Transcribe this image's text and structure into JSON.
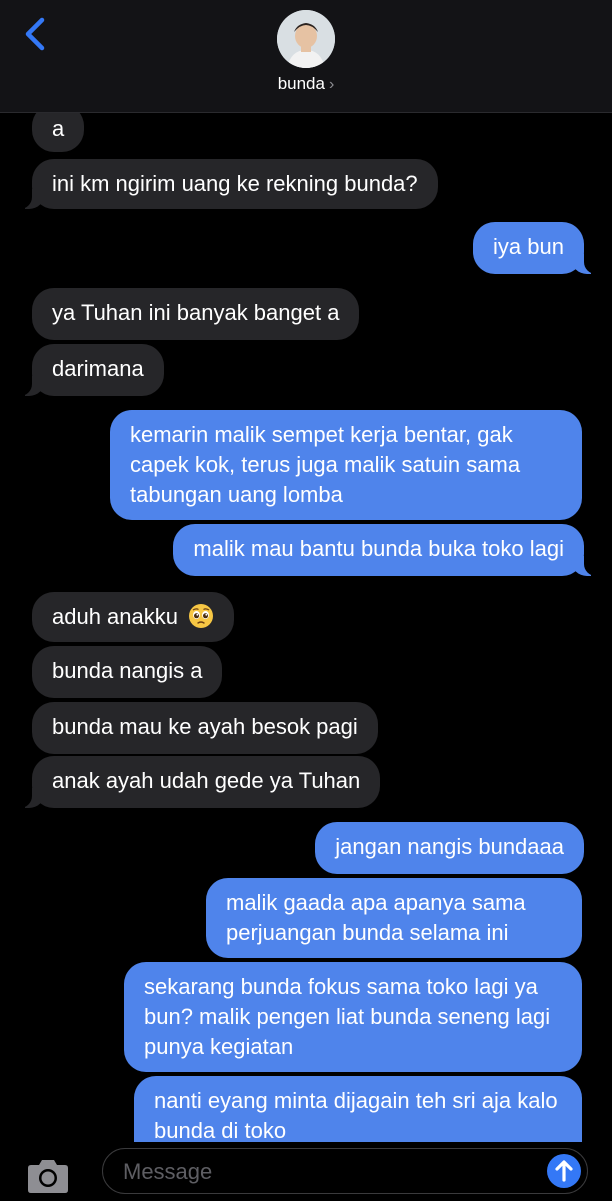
{
  "header": {
    "contact_name": "bunda",
    "chevron": "›",
    "back_icon": "chevron-left-icon",
    "accent": "#3478f6"
  },
  "messages": [
    {
      "from": "contact",
      "text": "a"
    },
    {
      "from": "contact",
      "text": "ini km ngirim uang ke rekning bunda?"
    },
    {
      "from": "me",
      "text": "iya bun"
    },
    {
      "from": "contact",
      "text": "ya Tuhan ini banyak banget a"
    },
    {
      "from": "contact",
      "text": "darimana"
    },
    {
      "from": "me",
      "text": "kemarin malik sempet kerja bentar, gak capek kok, terus juga malik satuin sama tabungan uang lomba"
    },
    {
      "from": "me",
      "text": "malik mau bantu bunda buka toko lagi"
    },
    {
      "from": "contact",
      "text": "aduh anakku",
      "emoji": "pleading-face"
    },
    {
      "from": "contact",
      "text": "bunda nangis a"
    },
    {
      "from": "contact",
      "text": "bunda mau ke ayah besok pagi"
    },
    {
      "from": "contact",
      "text": "anak ayah udah gede ya Tuhan"
    },
    {
      "from": "me",
      "text": "jangan nangis bundaaa"
    },
    {
      "from": "me",
      "text": "malik gaada apa apanya sama perjuangan bunda selama ini"
    },
    {
      "from": "me",
      "text": "sekarang bunda fokus sama toko lagi ya bun? malik pengen liat bunda seneng lagi punya kegiatan"
    },
    {
      "from": "me",
      "text": "nanti eyang minta dijagain teh sri aja kalo bunda di toko"
    }
  ],
  "input": {
    "placeholder": "Message",
    "camera_icon": "camera-icon",
    "send_icon": "arrow-up-icon"
  },
  "colors": {
    "incoming_bubble": "#262629",
    "outgoing_bubble": "#4f84eb",
    "background": "#000000"
  }
}
